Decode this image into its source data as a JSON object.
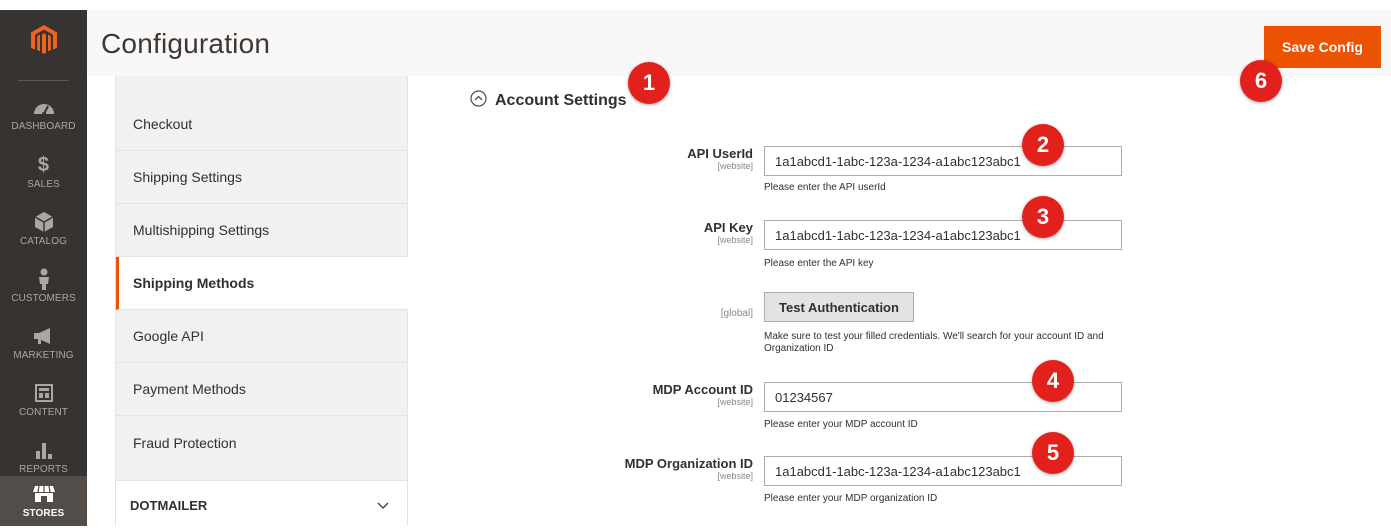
{
  "header": {
    "title": "Configuration",
    "save_label": "Save Config"
  },
  "admin_nav": {
    "items": [
      {
        "label": "DASHBOARD",
        "icon": "dashboard-icon"
      },
      {
        "label": "SALES",
        "icon": "dollar-icon"
      },
      {
        "label": "CATALOG",
        "icon": "box-icon"
      },
      {
        "label": "CUSTOMERS",
        "icon": "person-icon"
      },
      {
        "label": "MARKETING",
        "icon": "megaphone-icon"
      },
      {
        "label": "CONTENT",
        "icon": "layout-icon"
      },
      {
        "label": "REPORTS",
        "icon": "bar-chart-icon"
      },
      {
        "label": "STORES",
        "icon": "store-icon"
      }
    ],
    "active": "STORES"
  },
  "config_tabs": {
    "items": [
      {
        "label": "Checkout"
      },
      {
        "label": "Shipping Settings"
      },
      {
        "label": "Multishipping Settings"
      },
      {
        "label": "Shipping Methods"
      },
      {
        "label": "Google API"
      },
      {
        "label": "Payment Methods"
      },
      {
        "label": "Fraud Protection"
      }
    ],
    "active": "Shipping Methods",
    "group_label": "DOTMAILER"
  },
  "section": {
    "title": "Account Settings"
  },
  "fields": {
    "api_userid": {
      "label": "API UserId",
      "scope": "[website]",
      "value": "1a1abcd1-1abc-123a-1234-a1abc123abc1",
      "note": "Please enter the API userId"
    },
    "api_key": {
      "label": "API Key",
      "scope": "[website]",
      "value": "1a1abcd1-1abc-123a-1234-a1abc123abc1",
      "note": "Please enter the API key"
    },
    "test_auth": {
      "scope": "[global]",
      "button_label": "Test Authentication",
      "note": "Make sure to test your filled credentials. We'll search for your account ID and Organization ID"
    },
    "mdp_account_id": {
      "label": "MDP Account ID",
      "scope": "[website]",
      "value": "01234567",
      "note": "Please enter your MDP account ID"
    },
    "mdp_org_id": {
      "label": "MDP Organization ID",
      "scope": "[website]",
      "value": "1a1abcd1-1abc-123a-1234-a1abc123abc1",
      "note": "Please enter your MDP organization ID"
    }
  },
  "callouts": [
    "1",
    "2",
    "3",
    "4",
    "5",
    "6"
  ],
  "colors": {
    "accent": "#eb5202",
    "nav_bg": "#373330",
    "callout": "#e2211c"
  }
}
